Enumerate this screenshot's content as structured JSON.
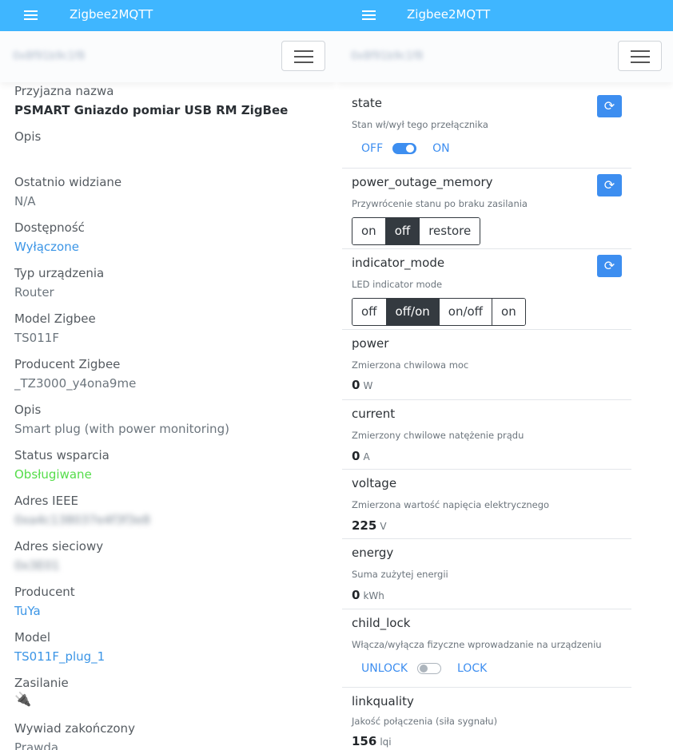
{
  "app_title": "Zigbee2MQTT",
  "device_header": "0x8f91b9c1f8",
  "info": [
    {
      "label": "Przyjazna nazwa",
      "value": "PSMART Gniazdo pomiar USB RM ZigBee",
      "style": "strong"
    },
    {
      "label": "Opis",
      "value": "",
      "style": ""
    },
    {
      "label": "Ostatnio widziane",
      "value": "N/A",
      "style": ""
    },
    {
      "label": "Dostępność",
      "value": "Wyłączone",
      "style": "link"
    },
    {
      "label": "Typ urządzenia",
      "value": "Router",
      "style": ""
    },
    {
      "label": "Model Zigbee",
      "value": "TS011F",
      "style": ""
    },
    {
      "label": "Producent Zigbee",
      "value": "_TZ3000_y4ona9me",
      "style": ""
    },
    {
      "label": "Opis",
      "value": "Smart plug (with power monitoring)",
      "style": ""
    },
    {
      "label": "Status wsparcia",
      "value": "Obsługiwane",
      "style": "green"
    },
    {
      "label": "Adres IEEE",
      "value": "0xa4c138037e4f3f3e8",
      "style": "blur"
    },
    {
      "label": "Adres sieciowy",
      "value": "0x3E01",
      "style": "blur"
    },
    {
      "label": "Producent",
      "value": "TuYa",
      "style": "link"
    },
    {
      "label": "Model",
      "value": "TS011F_plug_1",
      "style": "link"
    },
    {
      "label": "Zasilanie",
      "value": "🔌",
      "style": "plug"
    },
    {
      "label": "Wywiad zakończony",
      "value": "Prawda",
      "style": ""
    }
  ],
  "exposes": {
    "state": {
      "name": "state",
      "desc": "Stan wł/wył tego przełącznika",
      "off_label": "OFF",
      "on_label": "ON",
      "is_on": true
    },
    "power_outage_memory": {
      "name": "power_outage_memory",
      "desc": "Przywrócenie stanu po braku zasilania",
      "options": [
        "on",
        "off",
        "restore"
      ],
      "selected": "off"
    },
    "indicator_mode": {
      "name": "indicator_mode",
      "desc": "LED indicator mode",
      "options": [
        "off",
        "off/on",
        "on/off",
        "on"
      ],
      "selected": "off/on"
    },
    "power": {
      "name": "power",
      "desc": "Zmierzona chwilowa moc",
      "value": "0",
      "unit": "W"
    },
    "current": {
      "name": "current",
      "desc": "Zmierzony chwilowe natężenie prądu",
      "value": "0",
      "unit": "A"
    },
    "voltage": {
      "name": "voltage",
      "desc": "Zmierzona wartość napięcia elektrycznego",
      "value": "225",
      "unit": "V"
    },
    "energy": {
      "name": "energy",
      "desc": "Suma zużytej energii",
      "value": "0",
      "unit": "kWh"
    },
    "child_lock": {
      "name": "child_lock",
      "desc": "Włącza/wyłącza fizyczne wprowadzanie na urządzeniu",
      "off_label": "UNLOCK",
      "on_label": "LOCK",
      "is_on": false
    },
    "linkquality": {
      "name": "linkquality",
      "desc": "Jakość połączenia (siła sygnału)",
      "value": "156",
      "unit": "lqi"
    }
  },
  "colors": {
    "topbar": "#3fb6ff",
    "accent": "#3d8ef0",
    "success": "#55dd4a",
    "dark": "#343a40"
  }
}
